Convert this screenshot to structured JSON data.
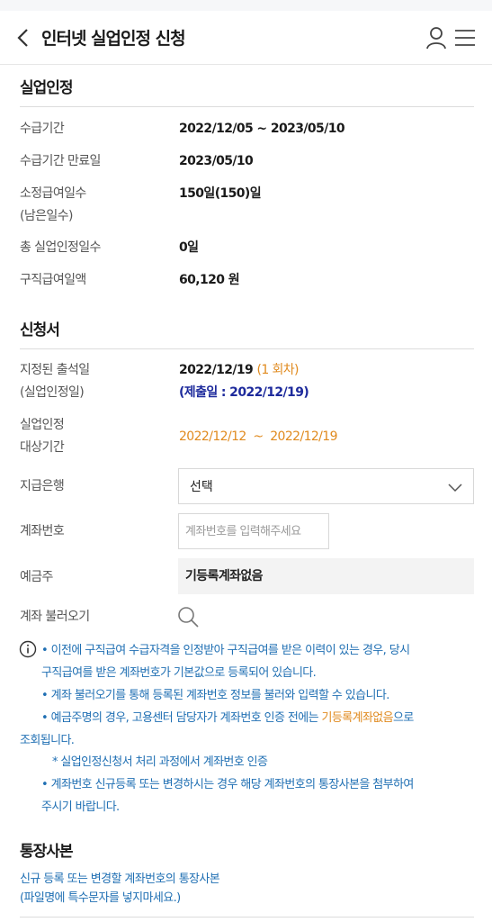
{
  "header": {
    "title": "인터넷 실업인정 신청",
    "back_icon": "chevron-left-icon",
    "user_icon": "user-icon",
    "menu_icon": "hamburger-menu-icon"
  },
  "unemployment": {
    "title": "실업인정",
    "rows": [
      {
        "label": "수급기간",
        "value": "2022/12/05 ~ 2023/05/10"
      },
      {
        "label": "수급기간 만료일",
        "value": "2023/05/10"
      },
      {
        "label": "소정급여일수",
        "label2": "(남은일수)",
        "value": "150일(150)일"
      },
      {
        "label": "총 실업인정일수",
        "value": "0일"
      },
      {
        "label": "구직급여일액",
        "value": "60,120 원"
      }
    ]
  },
  "application": {
    "title": "신청서",
    "attend_label": "지정된 출석일",
    "attend_label2": "(실업인정일)",
    "attend_date": "2022/12/19",
    "attend_count": "(1 회차)",
    "submit_date": "(제출일 : 2022/12/19)",
    "period_label": "실업인정",
    "period_label2": "대상기간",
    "period_value": "2022/12/12  ~  2022/12/19",
    "bank_label": "지급은행",
    "bank_selected": "선택",
    "account_label": "계좌번호",
    "account_placeholder": "계좌번호를 입력해주세요",
    "holder_label": "예금주",
    "holder_value": "기등록계좌없음",
    "fetch_label": "계좌 불러오기"
  },
  "notes": {
    "line1": "•  이전에 구직급여 수급자격을 인정받아 구직급여를 받은 이력이 있는 경우, 당시",
    "line1b": "구직급여를 받은 계좌번호가 기본값으로 등록되어 있습니다.",
    "line2": "•  계좌 불러오기를 통해 등록된 계좌번호 정보를 불러와 입력할 수 있습니다.",
    "line3a": "•  예금주명의 경우, 고용센터 담당자가 계좌번호 인증 전에는 ",
    "line3_highlight": "기등록계좌없음",
    "line3c": "으로",
    "line3b": "조회됩니다.",
    "line4": "* 실업인정신청서 처리 과정에서 계좌번호 인증",
    "line5": "•  계좌번호 신규등록 또는 변경하시는 경우 해당 계좌번호의 통장사본을 첨부하여",
    "line5b": "주시기 바랍니다."
  },
  "bankbook": {
    "title": "통장사본",
    "desc1": "신규 등록 또는 변경할 계좌번호의 통장사본",
    "desc2": "(파일명에 특수문자를 넣지마세요.)"
  },
  "colors": {
    "accent_blue": "#1f6fb3",
    "navy": "#1d2a9c",
    "orange": "#e08a1e"
  }
}
